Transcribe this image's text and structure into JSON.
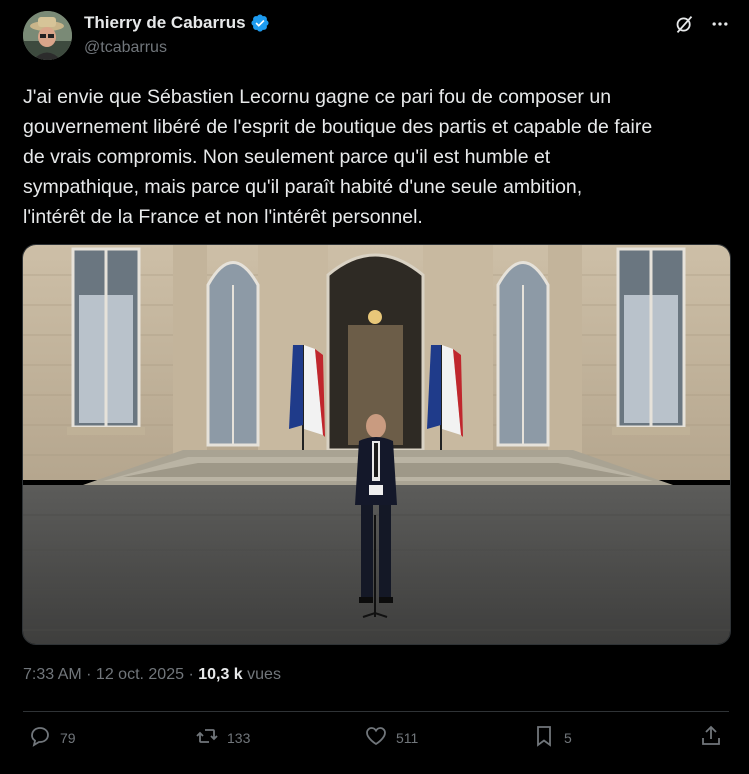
{
  "author": {
    "display_name": "Thierry de Cabarrus",
    "handle": "@tcabarrus",
    "verified": true
  },
  "icons": {
    "grok": "grok-icon",
    "more": "more-icon",
    "reply": "reply-icon",
    "retweet": "retweet-icon",
    "like": "heart-icon",
    "bookmark": "bookmark-icon",
    "share": "share-icon"
  },
  "tweet": {
    "lines": [
      "J'ai envie que Sébastien Lecornu gagne ce pari fou de composer un",
      "gouvernement libéré de l'esprit de boutique des partis et capable de faire",
      "de vrais compromis. Non seulement parce qu'il est humble et",
      "sympathique, mais parce qu'il paraît habité d'une seule ambition,",
      "l'intérêt de la France et non l'intérêt personnel."
    ]
  },
  "meta": {
    "time": "7:33 AM",
    "sep1": " · ",
    "date": "12 oct. 2025",
    "sep2": " · ",
    "views": "10,3 k",
    "views_label": " vues"
  },
  "actions": {
    "replies": "79",
    "retweets": "133",
    "likes": "511",
    "bookmarks": "5"
  },
  "colors": {
    "background": "#000000",
    "text": "#e7e9ea",
    "muted": "#71767b",
    "verified": "#1d9bf0",
    "divider": "#2f3336"
  }
}
